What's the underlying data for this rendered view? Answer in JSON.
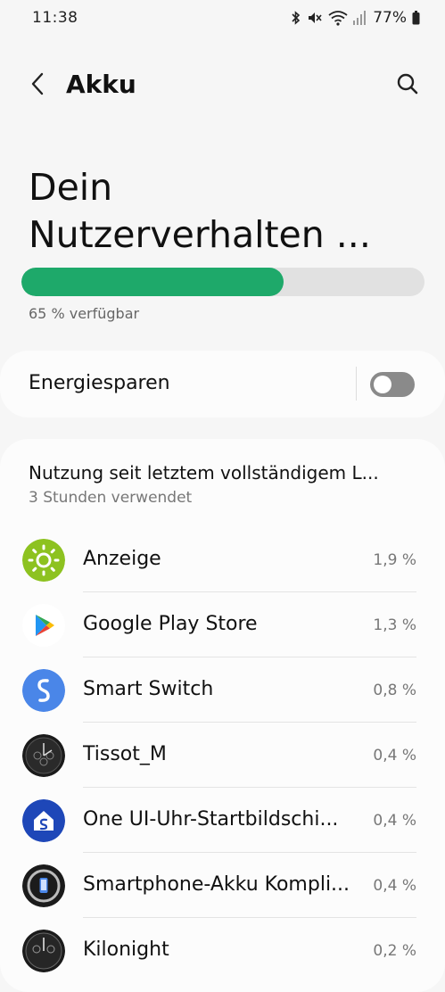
{
  "status_bar": {
    "time": "11:38",
    "battery_text": "77%",
    "icons": [
      "bluetooth-icon",
      "mute-icon",
      "wifi-icon",
      "signal-icon",
      "battery-icon"
    ]
  },
  "app_bar": {
    "title": "Akku",
    "back_icon": "back-arrow-icon",
    "search_icon": "search-icon"
  },
  "headline": {
    "line1": "Dein",
    "line2": "Nutzerverhalten ..."
  },
  "battery": {
    "level_percent": 65,
    "caption": "65 % verfügbar",
    "fill_color": "#1ea96a"
  },
  "power_saving": {
    "label": "Energiesparen",
    "enabled": false
  },
  "usage": {
    "title": "Nutzung seit letztem vollständigem L...",
    "subtitle": "3 Stunden verwendet",
    "apps": [
      {
        "name": "Anzeige",
        "percent": "1,9 %",
        "icon": "sun-icon"
      },
      {
        "name": "Google Play Store",
        "percent": "1,3 %",
        "icon": "play-store-icon"
      },
      {
        "name": "Smart Switch",
        "percent": "0,8 %",
        "icon": "smart-switch-icon"
      },
      {
        "name": "Tissot_M",
        "percent": "0,4 %",
        "icon": "watch-face-icon"
      },
      {
        "name": "One UI-Uhr-Startbildschi...",
        "percent": "0,4 %",
        "icon": "one-ui-home-icon"
      },
      {
        "name": "Smartphone-Akku Kompli...",
        "percent": "0,4 %",
        "icon": "phone-battery-complication-icon"
      },
      {
        "name": "Kilonight",
        "percent": "0,2 %",
        "icon": "watch-face-icon"
      }
    ]
  }
}
